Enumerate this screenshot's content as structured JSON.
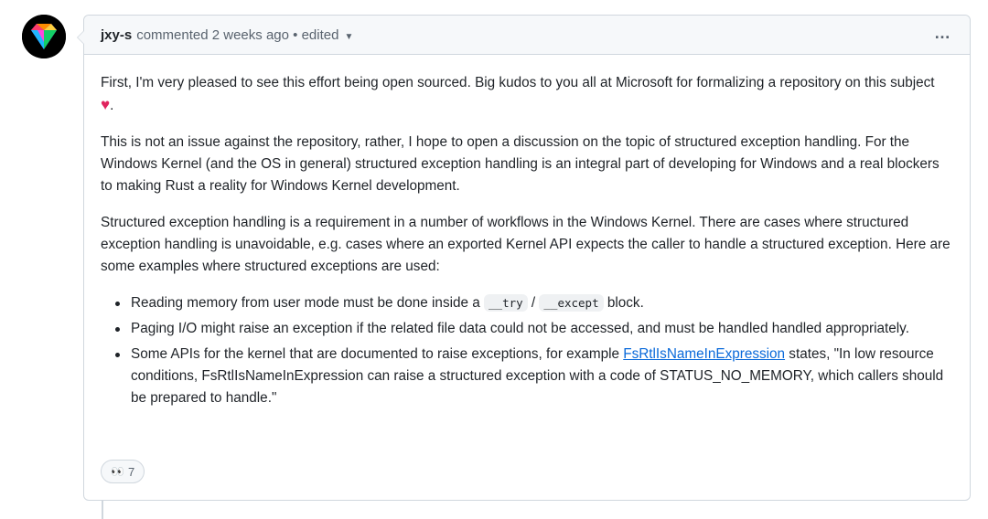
{
  "comment": {
    "author": "jxy-s",
    "action": "commented",
    "time": "2 weeks ago",
    "separator": "•",
    "edited": "edited",
    "more_icon": "…",
    "paragraphs": {
      "p1_text": "First, I'm very pleased to see this effort being open sourced. Big kudos to you all at Microsoft for formalizing a repository on this subject",
      "p1_heart": "♥",
      "p1_end": ".",
      "p2": "This is not an issue against the repository, rather, I hope to open a discussion on the topic of structured exception handling. For the Windows Kernel (and the OS in general) structured exception handling is an integral part of developing for Windows and a real blockers to making Rust a reality for Windows Kernel development.",
      "p3": "Structured exception handling is a requirement in a number of workflows in the Windows Kernel. There are cases where structured exception handling is unavoidable, e.g. cases where an exported Kernel API expects the caller to handle a structured exception. Here are some examples where structured exceptions are used:"
    },
    "bullets": {
      "b1_before": "Reading memory from user mode must be done inside a ",
      "b1_code1": "__try",
      "b1_slash": " / ",
      "b1_code2": "__except",
      "b1_after": " block.",
      "b2": "Paging I/O might raise an exception if the related file data could not be accessed, and must be handled handled appropriately.",
      "b3_before": "Some APIs for the kernel that are documented to raise exceptions, for example ",
      "b3_link": "FsRtlIsNameInExpression",
      "b3_after": " states, \"In low resource conditions, FsRtlIsNameInExpression can raise a structured exception with a code of STATUS_NO_MEMORY, which callers should be prepared to handle.\""
    },
    "reaction": {
      "emoji": "👀",
      "count": "7"
    }
  },
  "colors": {
    "link": "#0969da",
    "border": "#d0d7de",
    "header_bg": "#f6f8fa",
    "heart": "#e0245e"
  }
}
